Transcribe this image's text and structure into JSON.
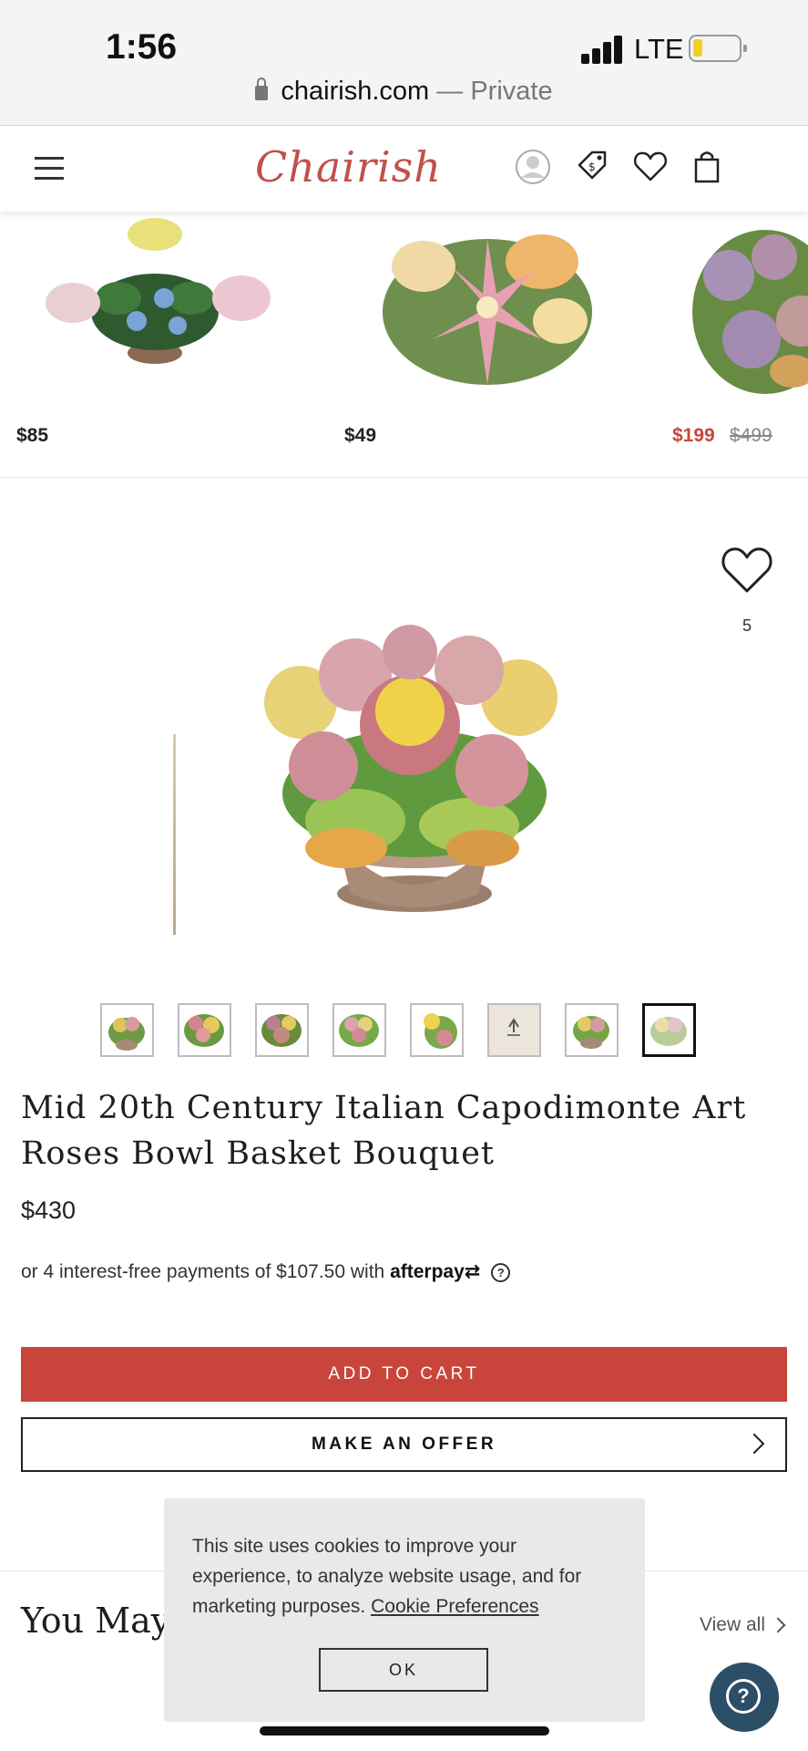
{
  "status_bar": {
    "time": "1:56",
    "network": "LTE"
  },
  "url_bar": {
    "domain": "chairish.com",
    "separator": " — ",
    "mode": "Private"
  },
  "header": {
    "logo": "Chairish"
  },
  "carousel": [
    {
      "price": "$85"
    },
    {
      "price": "$49"
    },
    {
      "price": "$199",
      "original_price": "$499"
    }
  ],
  "product": {
    "favorite_count": "5",
    "title": "Mid 20th Century Italian Capodimonte Art Roses Bowl Basket Bouquet",
    "price": "$430",
    "afterpay_text": "or 4 interest-free payments of $107.50 with",
    "afterpay_brand": "afterpay",
    "add_to_cart": "ADD TO CART",
    "make_offer": "MAKE AN OFFER"
  },
  "you_may": {
    "heading": "You May",
    "view_all": "View all"
  },
  "cookie_banner": {
    "text": "This site uses cookies to improve your experience, to analyze website usage, and for marketing purposes.",
    "link": "Cookie Preferences",
    "ok": "OK"
  },
  "help_button": {
    "symbol": "?"
  },
  "colors": {
    "brand": "#c0504a",
    "cta": "#c9453b",
    "sale": "#c9453b",
    "help": "#2c4e66"
  },
  "icons": [
    "lock-icon",
    "menu-icon",
    "account-icon",
    "price-tag-icon",
    "heart-icon",
    "shopping-bag-icon",
    "chevron-right-icon",
    "help-icon"
  ]
}
